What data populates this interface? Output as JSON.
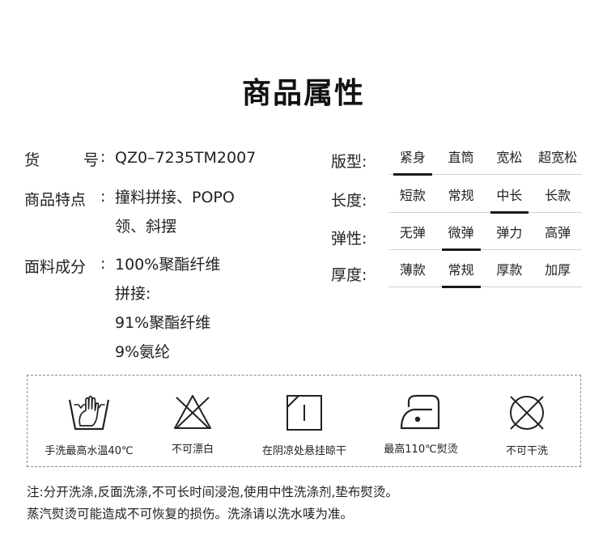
{
  "title": "商品属性",
  "info": {
    "item_no": {
      "key_chars": [
        "货",
        "号"
      ],
      "colon": ":",
      "value": "QZ0–7235TM2007"
    },
    "features": {
      "key": "商品特点",
      "colon": ":",
      "lines": [
        "撞料拼接、POPO",
        "领、斜摆"
      ]
    },
    "fabric": {
      "key": "面料成分",
      "colon": ":",
      "lines": [
        "100%聚酯纤维",
        "拼接:",
        "91%聚酯纤维",
        "9%氨纶"
      ]
    }
  },
  "attributes": [
    {
      "label": "版型:",
      "options": [
        "紧身",
        "直筒",
        "宽松",
        "超宽松"
      ],
      "selected": 0
    },
    {
      "label": "长度:",
      "options": [
        "短款",
        "常规",
        "中长",
        "长款"
      ],
      "selected": 2
    },
    {
      "label": "弹性:",
      "options": [
        "无弹",
        "微弹",
        "弹力",
        "高弹"
      ],
      "selected": 1
    },
    {
      "label": "厚度:",
      "options": [
        "薄款",
        "常规",
        "厚款",
        "加厚"
      ],
      "selected": 1
    }
  ],
  "care": [
    {
      "icon": "hand-wash-icon",
      "label": "手洗最高水温40℃"
    },
    {
      "icon": "no-bleach-icon",
      "label": "不可漂白"
    },
    {
      "icon": "line-dry-shade-icon",
      "label": "在阴凉处悬挂晾干"
    },
    {
      "icon": "iron-110-icon",
      "label": "最高110℃熨烫"
    },
    {
      "icon": "no-dry-clean-icon",
      "label": "不可干洗"
    }
  ],
  "note": {
    "line1": "注:分开洗涤,反面洗涤,不可长时间浸泡,使用中性洗涤剂,垫布熨烫。",
    "line2": "蒸汽熨烫可能造成不可恢复的损伤。洗涤请以洗水唛为准。"
  }
}
